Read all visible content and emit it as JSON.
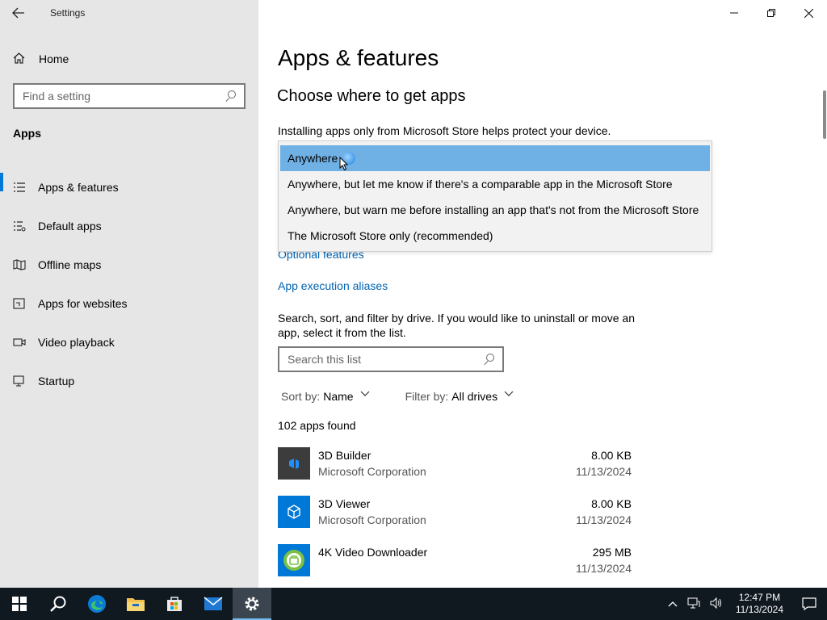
{
  "window": {
    "title": "Settings"
  },
  "sidebar": {
    "home_label": "Home",
    "search_placeholder": "Find a setting",
    "section_title": "Apps",
    "items": [
      {
        "label": "Apps & features",
        "icon": "list-icon",
        "active": true
      },
      {
        "label": "Default apps",
        "icon": "default-apps-icon"
      },
      {
        "label": "Offline maps",
        "icon": "map-icon"
      },
      {
        "label": "Apps for websites",
        "icon": "website-icon"
      },
      {
        "label": "Video playback",
        "icon": "video-icon"
      },
      {
        "label": "Startup",
        "icon": "startup-icon"
      }
    ]
  },
  "main": {
    "title": "Apps & features",
    "subtitle": "Choose where to get apps",
    "description": "Installing apps only from Microsoft Store helps protect your device.",
    "dropdown_options": [
      "Anywhere",
      "Anywhere, but let me know if there's a comparable app in the Microsoft Store",
      "Anywhere, but warn me before installing an app that's not from the Microsoft Store",
      "The Microsoft Store only (recommended)"
    ],
    "optional_features_link": "Optional features",
    "aliases_link": "App execution aliases",
    "help_text": "Search, sort, and filter by drive. If you would like to uninstall or move an app, select it from the list.",
    "list_search_placeholder": "Search this list",
    "sort_label": "Sort by:",
    "sort_value": "Name",
    "filter_label": "Filter by:",
    "filter_value": "All drives",
    "count": "102 apps found",
    "apps": [
      {
        "name": "3D Builder",
        "publisher": "Microsoft Corporation",
        "size": "8.00 KB",
        "date": "11/13/2024"
      },
      {
        "name": "3D Viewer",
        "publisher": "Microsoft Corporation",
        "size": "8.00 KB",
        "date": "11/13/2024"
      },
      {
        "name": "4K Video Downloader",
        "publisher": "",
        "size": "295 MB",
        "date": "11/13/2024"
      }
    ]
  },
  "taskbar": {
    "time": "12:47 PM",
    "date": "11/13/2024"
  },
  "colors": {
    "accent": "#0078d7",
    "selected": "#6fb0e5",
    "link": "#0063b1",
    "taskbar": "#101820"
  }
}
